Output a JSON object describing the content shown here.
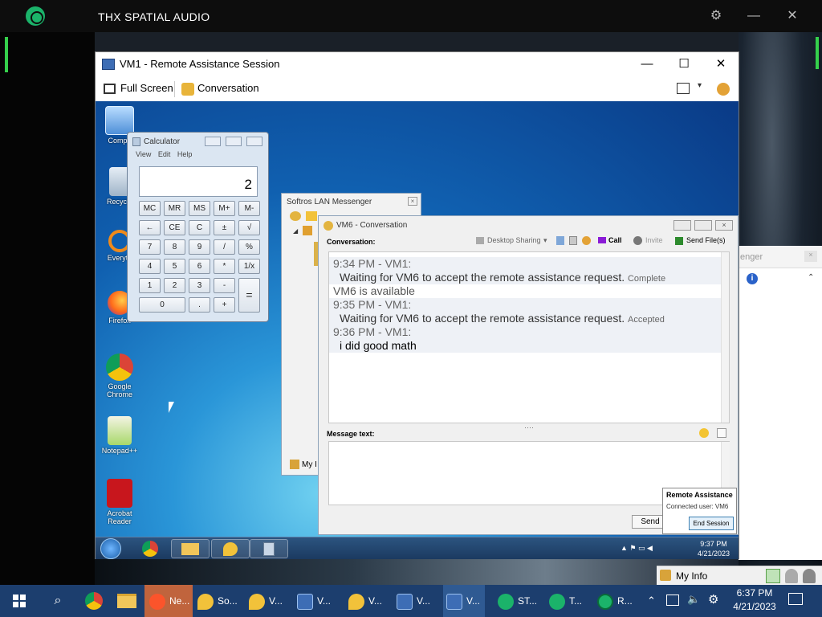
{
  "thx": {
    "title": "THX SPATIAL AUDIO",
    "settings_icon": "gear-icon",
    "minimize_icon": "minimize-icon",
    "close_icon": "close-icon"
  },
  "vm1_window": {
    "title": "VM1 - Remote Assistance Session",
    "toolbar": {
      "full_screen": "Full Screen",
      "conversation": "Conversation"
    }
  },
  "guest_desktop": {
    "icons": [
      {
        "label": "Compu",
        "icon": "computer-icon"
      },
      {
        "label": "Recycle",
        "icon": "recycle-bin-icon"
      },
      {
        "label": "Everyth",
        "icon": "everything-icon"
      },
      {
        "label": "Firefox",
        "icon": "firefox-icon"
      },
      {
        "label": "Google Chrome",
        "icon": "chrome-icon"
      },
      {
        "label": "Notepad++",
        "icon": "notepad-plus-icon"
      },
      {
        "label": "Acrobat Reader",
        "icon": "acrobat-icon"
      }
    ],
    "taskbar_clock": {
      "time": "9:37 PM",
      "date": "4/21/2023"
    }
  },
  "calculator": {
    "title": "Calculator",
    "menu": [
      "View",
      "Edit",
      "Help"
    ],
    "display": "2",
    "keys": [
      [
        "MC",
        "MR",
        "MS",
        "M+",
        "M-"
      ],
      [
        "←",
        "CE",
        "C",
        "±",
        "√"
      ],
      [
        "7",
        "8",
        "9",
        "/",
        "%"
      ],
      [
        "4",
        "5",
        "6",
        "*",
        "1/x"
      ],
      [
        "1",
        "2",
        "3",
        "-",
        "="
      ],
      [
        "0",
        ".",
        "+"
      ]
    ]
  },
  "lan_messenger": {
    "title": "Softros LAN Messenger",
    "footer": "My I"
  },
  "conversation_window": {
    "title": "VM6 - Conversation",
    "label": "Conversation:",
    "tools": {
      "desktop_sharing": "Desktop Sharing",
      "call": "Call",
      "invite": "Invite",
      "send_files": "Send File(s)"
    },
    "messages": [
      {
        "header": "9:34 PM - VM1:",
        "body": "Waiting for VM6 to accept the remote assistance request.",
        "note": "Complete"
      },
      {
        "header": "",
        "body": "VM6 is available",
        "note": ""
      },
      {
        "header": "9:35 PM - VM1:",
        "body": "Waiting for VM6 to accept the remote assistance request.",
        "note": "Accepted"
      },
      {
        "header": "9:36 PM - VM1:",
        "body": "i did good math",
        "note": ""
      }
    ],
    "message_label": "Message text:",
    "send": "Send"
  },
  "remote_assistance_popup": {
    "title": "Remote Assistance",
    "connected_user": "Connected user: VM6",
    "end_session": "End Session"
  },
  "softros_side": {
    "title_fragment": "enger",
    "my_info": "My Info"
  },
  "host_taskbar": {
    "items": [
      {
        "label": "Ne...",
        "icon": "brave-icon"
      },
      {
        "label": "So...",
        "icon": "softros-icon"
      },
      {
        "label": "V...",
        "icon": "softros-icon"
      },
      {
        "label": "V...",
        "icon": "vm-icon"
      },
      {
        "label": "V...",
        "icon": "softros-icon"
      },
      {
        "label": "V...",
        "icon": "vm-icon"
      },
      {
        "label": "V...",
        "icon": "vm-icon"
      },
      {
        "label": "ST...",
        "icon": "thx-icon"
      },
      {
        "label": "T...",
        "icon": "thx-icon"
      },
      {
        "label": "R...",
        "icon": "razer-icon"
      }
    ],
    "clock": {
      "time": "6:37 PM",
      "date": "4/21/2023"
    }
  }
}
